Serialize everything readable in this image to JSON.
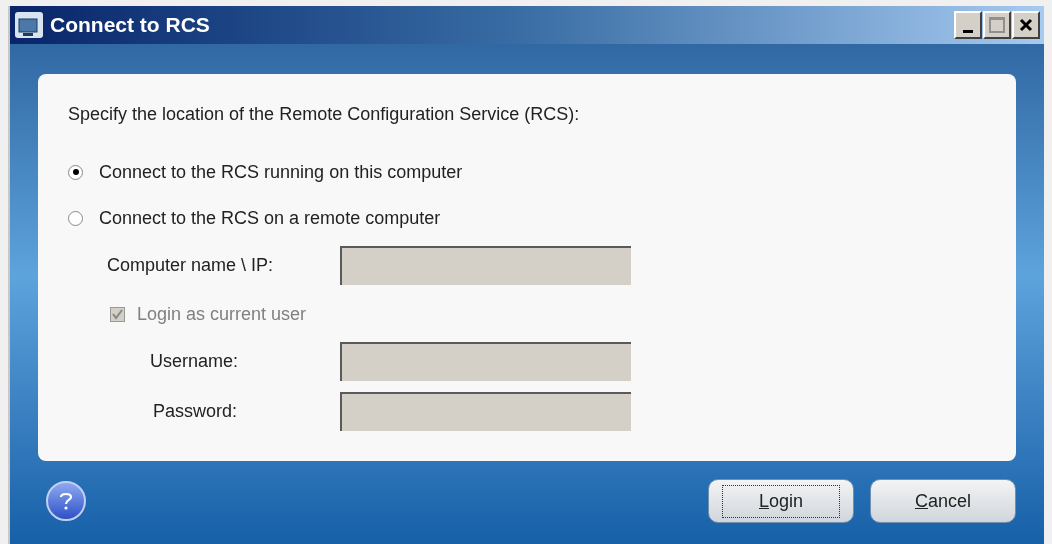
{
  "window": {
    "title": "Connect to RCS"
  },
  "intro": "Specify the location of the Remote Configuration Service (RCS):",
  "options": [
    {
      "label": "Connect to the RCS running on this computer",
      "selected": true
    },
    {
      "label": "Connect to the RCS on a remote computer",
      "selected": false
    }
  ],
  "computer_field": {
    "label": "Computer name \\ IP:",
    "disabled": true
  },
  "login_checkbox": {
    "label": "Login as current user",
    "checked": true,
    "disabled": true
  },
  "credential_fields": [
    {
      "label": "Username:",
      "disabled": true
    },
    {
      "label": "Password:",
      "disabled": true
    }
  ],
  "buttons": [
    {
      "label": "Login",
      "focused": true
    },
    {
      "label": "Cancel",
      "focused": false
    }
  ]
}
